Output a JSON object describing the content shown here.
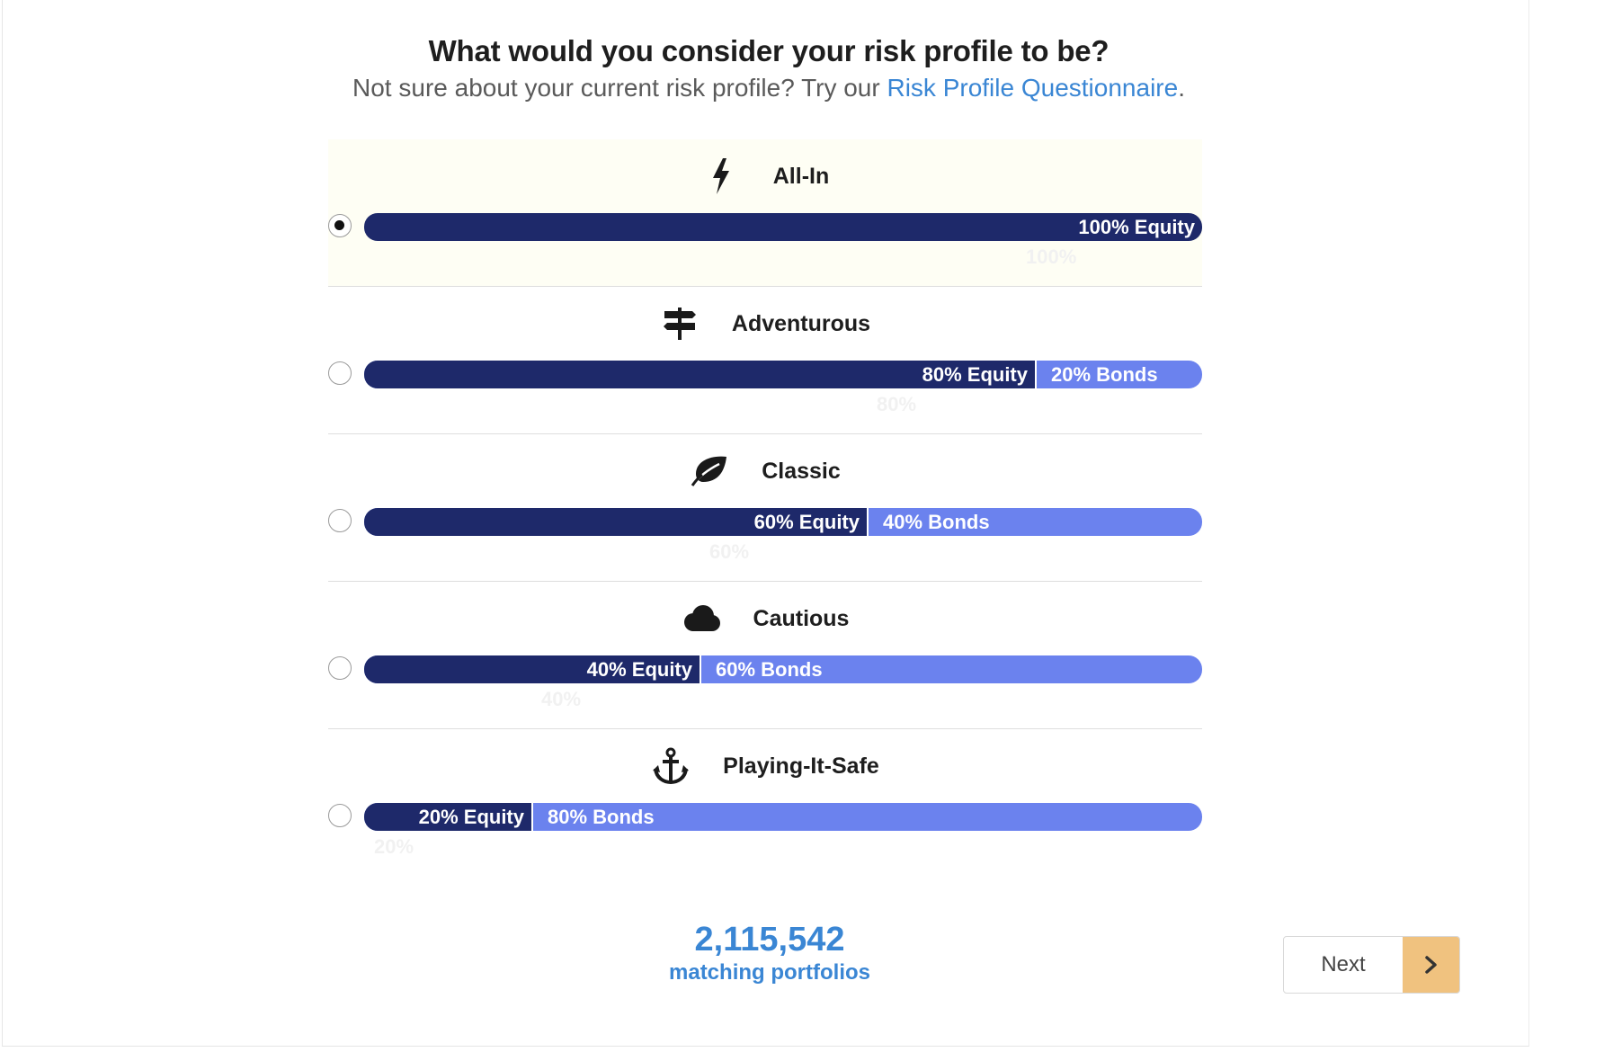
{
  "header": {
    "question": "What would you consider your risk profile to be?",
    "subtitle": "Not sure about your current risk profile? Try our",
    "link_text": "Risk Profile Questionnaire",
    "link_suffix": "."
  },
  "colors": {
    "equity": "#1e296a",
    "bonds": "#6b82ee",
    "link": "#3a86d4",
    "selected_bg": "#fefef4",
    "next_arrow_bg": "#f0c27f"
  },
  "options": [
    {
      "name": "All-In",
      "icon": "lightning-icon",
      "selected": true,
      "equity_pct": 100,
      "equity_label": "100% Equity",
      "bonds_label": "",
      "ghost_label": "100%"
    },
    {
      "name": "Adventurous",
      "icon": "signpost-icon",
      "selected": false,
      "equity_pct": 80,
      "equity_label": "80% Equity",
      "bonds_label": "20% Bonds",
      "ghost_label": "80%"
    },
    {
      "name": "Classic",
      "icon": "leaf-icon",
      "selected": false,
      "equity_pct": 60,
      "equity_label": "60% Equity",
      "bonds_label": "40% Bonds",
      "ghost_label": "60%"
    },
    {
      "name": "Cautious",
      "icon": "cloud-icon",
      "selected": false,
      "equity_pct": 40,
      "equity_label": "40% Equity",
      "bonds_label": "60% Bonds",
      "ghost_label": "40%"
    },
    {
      "name": "Playing-It-Safe",
      "icon": "anchor-icon",
      "selected": false,
      "equity_pct": 20,
      "equity_label": "20% Equity",
      "bonds_label": "80% Bonds",
      "ghost_label": "20%"
    }
  ],
  "footer": {
    "count": "2,115,542",
    "count_label": "matching portfolios",
    "next_label": "Next",
    "next_icon": "chevron-right-icon"
  }
}
